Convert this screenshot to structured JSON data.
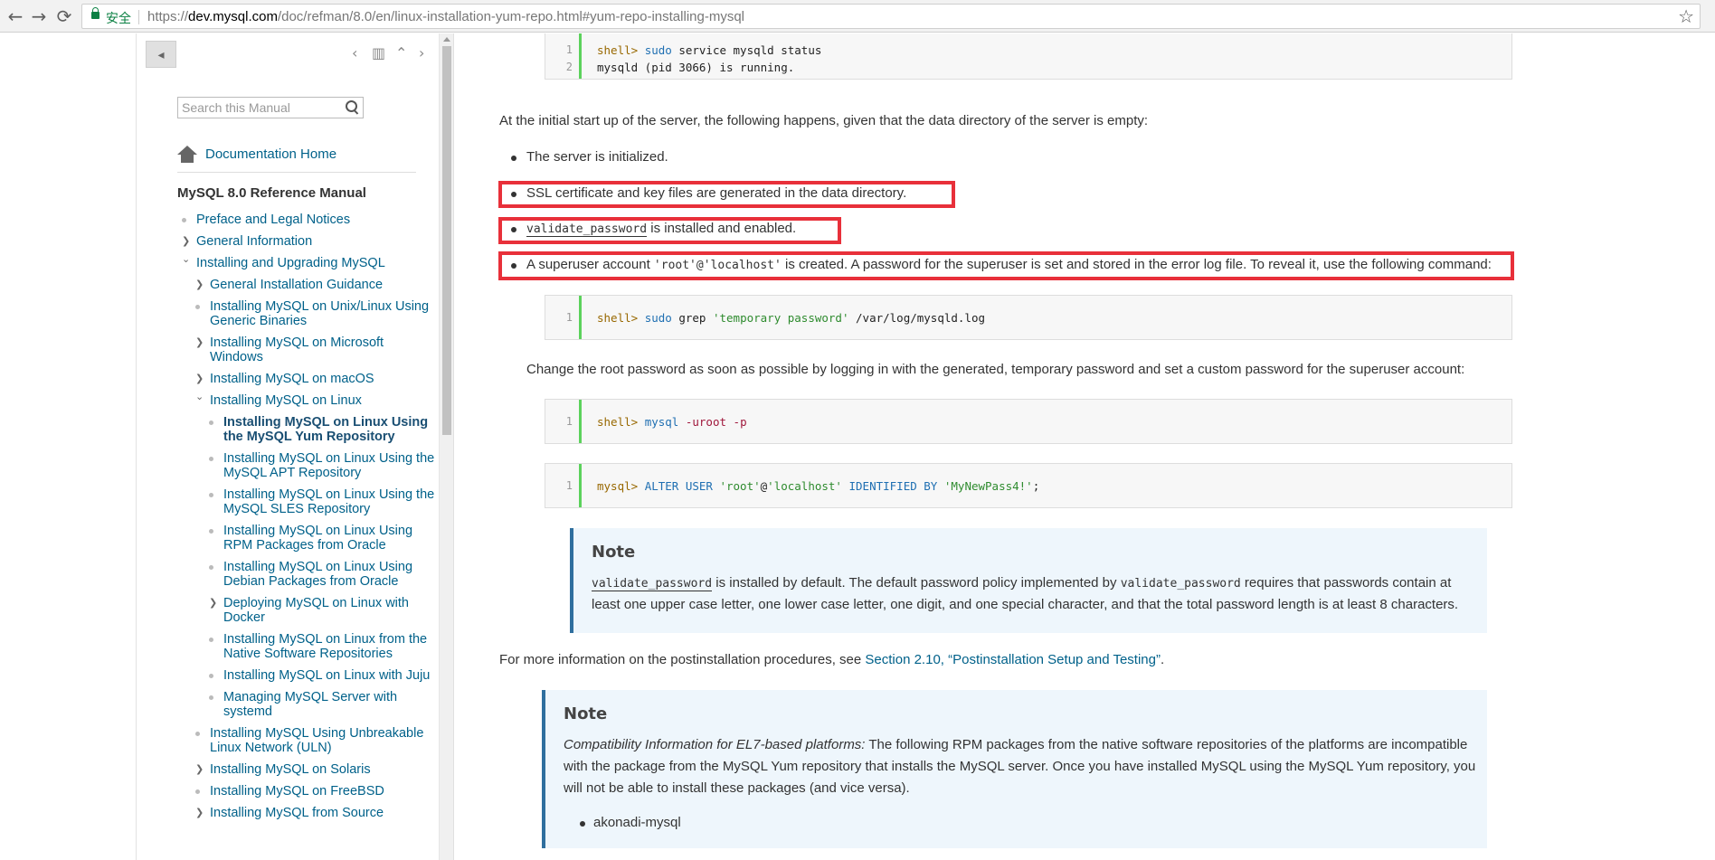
{
  "browser": {
    "secure_label": "安全",
    "url_scheme": "https://",
    "url_host": "dev.mysql.com",
    "url_path": "/doc/refman/8.0/en/linux-installation-yum-repo.html#yum-repo-installing-mysql",
    "back_glyph": "←",
    "forward_glyph": "→",
    "reload_glyph": "⟳",
    "star_glyph": "☆"
  },
  "sidebar": {
    "collapse_glyph": "◂",
    "toolbar_icons": {
      "prev": "‹",
      "book": "▥",
      "up": "⌃",
      "next": "›"
    },
    "search_placeholder": "Search this Manual",
    "doc_home": "Documentation Home",
    "manual_title": "MySQL 8.0 Reference Manual",
    "toc": [
      {
        "label": "Preface and Legal Notices",
        "level": 0,
        "marker": "dot",
        "lines": 1
      },
      {
        "label": "General Information",
        "level": 0,
        "marker": "collapsed",
        "lines": 1
      },
      {
        "label": "Installing and Upgrading MySQL",
        "level": 0,
        "marker": "expanded",
        "lines": 1
      },
      {
        "label": "General Installation Guidance",
        "level": 1,
        "marker": "collapsed",
        "lines": 1
      },
      {
        "label": "Installing MySQL on Unix/Linux Using Generic Binaries",
        "level": 1,
        "marker": "dot",
        "lines": 2
      },
      {
        "label": "Installing MySQL on Microsoft Windows",
        "level": 1,
        "marker": "collapsed",
        "lines": 2
      },
      {
        "label": "Installing MySQL on macOS",
        "level": 1,
        "marker": "collapsed",
        "lines": 1
      },
      {
        "label": "Installing MySQL on Linux",
        "level": 1,
        "marker": "expanded",
        "lines": 1
      },
      {
        "label": "Installing MySQL on Linux Using the MySQL Yum Repository",
        "level": 2,
        "marker": "dot",
        "lines": 3,
        "current": true
      },
      {
        "label": "Installing MySQL on Linux Using the MySQL APT Repository",
        "level": 2,
        "marker": "dot",
        "lines": 2
      },
      {
        "label": "Installing MySQL on Linux Using the MySQL SLES Repository",
        "level": 2,
        "marker": "dot",
        "lines": 2
      },
      {
        "label": "Installing MySQL on Linux Using RPM Packages from Oracle",
        "level": 2,
        "marker": "dot",
        "lines": 2
      },
      {
        "label": "Installing MySQL on Linux Using Debian Packages from Oracle",
        "level": 2,
        "marker": "dot",
        "lines": 2
      },
      {
        "label": "Deploying MySQL on Linux with Docker",
        "level": 2,
        "marker": "collapsed",
        "lines": 2
      },
      {
        "label": "Installing MySQL on Linux from the Native Software Repositories",
        "level": 2,
        "marker": "dot",
        "lines": 2
      },
      {
        "label": "Installing MySQL on Linux with Juju",
        "level": 2,
        "marker": "dot",
        "lines": 2
      },
      {
        "label": "Managing MySQL Server with systemd",
        "level": 2,
        "marker": "dot",
        "lines": 2
      },
      {
        "label": "Installing MySQL Using Unbreakable Linux Network (ULN)",
        "level": 1,
        "marker": "dot",
        "lines": 2
      },
      {
        "label": "Installing MySQL on Solaris",
        "level": 1,
        "marker": "collapsed",
        "lines": 1
      },
      {
        "label": "Installing MySQL on FreeBSD",
        "level": 1,
        "marker": "dot",
        "lines": 1
      },
      {
        "label": "Installing MySQL from Source",
        "level": 1,
        "marker": "collapsed",
        "lines": 1
      }
    ]
  },
  "content": {
    "code1": {
      "line1_no": "1",
      "line1_prompt": "shell>",
      "line1_cmd": "sudo",
      "line1_rest": "service mysqld status",
      "line2_no": "2",
      "line2_text": "mysqld (pid 3066) is running."
    },
    "intro": "At the initial start up of the server, the following happens, given that the data directory of the server is empty:",
    "bullet1": "The server is initialized.",
    "bullet2": "SSL certificate and key files are generated in the data directory.",
    "bullet3_code": "validate_password",
    "bullet3_text": " is installed and enabled.",
    "bullet4_pre": "A superuser account ",
    "bullet4_code": "'root'@'localhost'",
    "bullet4_post": " is created. A password for the superuser is set and stored in the error log file. To reveal it, use the following command:",
    "code2": {
      "no": "1",
      "prompt": "shell>",
      "cmd": "sudo",
      "grep": "grep",
      "str": "'temporary password'",
      "path": "/var/log/mysqld.log"
    },
    "change_root": "Change the root password as soon as possible by logging in with the generated, temporary password and set a custom password for the superuser account:",
    "code3": {
      "no": "1",
      "prompt": "shell>",
      "cmd": "mysql",
      "flags": "-uroot -p"
    },
    "code4": {
      "no": "1",
      "prompt": "mysql>",
      "kw1": "ALTER USER",
      "user": "'root'",
      "at": "@",
      "host": "'localhost'",
      "kw2": "IDENTIFIED BY",
      "pass": "'MyNewPass4!'",
      "semi": ";"
    },
    "note1": {
      "title": "Note",
      "code_a": "validate_password",
      "text_a": " is installed by default. The default password policy implemented by ",
      "code_b": "validate_password",
      "text_b": " requires that passwords contain at",
      "line2": "least one upper case letter, one lower case letter, one digit, and one special character, and that the total password length is at least 8 characters."
    },
    "more_info_pre": "For more information on the postinstallation procedures, see ",
    "more_info_link": "Section 2.10, “Postinstallation Setup and Testing”",
    "more_info_post": ".",
    "note2": {
      "title": "Note",
      "em": "Compatibility Information for EL7-based platforms:",
      "line1_rest": " The following RPM packages from the native software repositories of the platforms are incompatible",
      "line2": "with the package from the MySQL Yum repository that installs the MySQL server. Once you have installed MySQL using the MySQL Yum repository, you",
      "line3": "will not be able to install these packages (and vice versa).",
      "item1": "akonadi-mysql"
    }
  }
}
